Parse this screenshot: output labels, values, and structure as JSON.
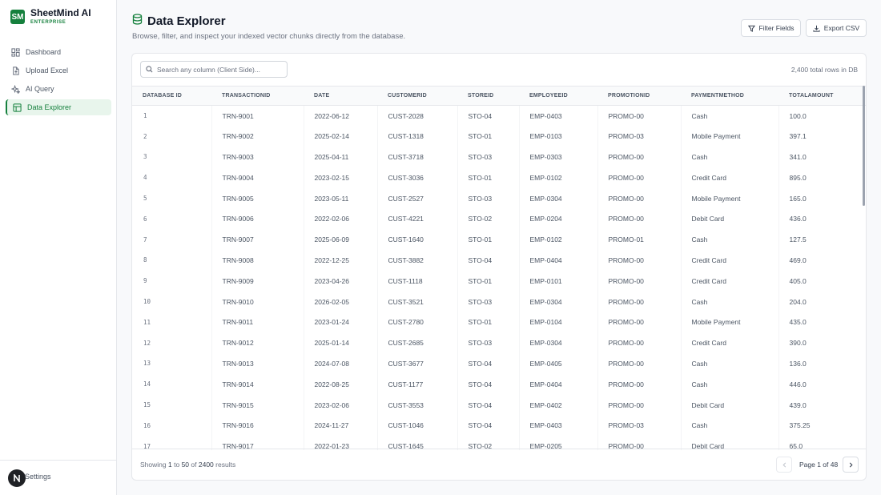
{
  "brand": {
    "logo": "SM",
    "name": "SheetMind AI",
    "sub": "ENTERPRISE"
  },
  "nav": [
    {
      "label": "Dashboard",
      "icon": "dashboard-icon"
    },
    {
      "label": "Upload Excel",
      "icon": "file-upload-icon"
    },
    {
      "label": "AI Query",
      "icon": "sparkles-icon"
    },
    {
      "label": "Data Explorer",
      "icon": "table-icon",
      "active": true
    }
  ],
  "settings_label": "Settings",
  "page": {
    "title": "Data Explorer",
    "subtitle": "Browse, filter, and inspect your indexed vector chunks directly from the database."
  },
  "actions": {
    "filter": "Filter Fields",
    "export": "Export CSV"
  },
  "search": {
    "placeholder": "Search any column (Client Side)..."
  },
  "total_rows": "2,400 total rows in DB",
  "columns": [
    "DATABASE ID",
    "TRANSACTIONID",
    "DATE",
    "CUSTOMERID",
    "STOREID",
    "EMPLOYEEID",
    "PROMOTIONID",
    "PAYMENTMETHOD",
    "TOTALAMOUNT"
  ],
  "rows": [
    [
      "1",
      "TRN-9001",
      "2022-06-12",
      "CUST-2028",
      "STO-04",
      "EMP-0403",
      "PROMO-00",
      "Cash",
      "100.0"
    ],
    [
      "2",
      "TRN-9002",
      "2025-02-14",
      "CUST-1318",
      "STO-01",
      "EMP-0103",
      "PROMO-03",
      "Mobile Payment",
      "397.1"
    ],
    [
      "3",
      "TRN-9003",
      "2025-04-11",
      "CUST-3718",
      "STO-03",
      "EMP-0303",
      "PROMO-00",
      "Cash",
      "341.0"
    ],
    [
      "4",
      "TRN-9004",
      "2023-02-15",
      "CUST-3036",
      "STO-01",
      "EMP-0102",
      "PROMO-00",
      "Credit Card",
      "895.0"
    ],
    [
      "5",
      "TRN-9005",
      "2023-05-11",
      "CUST-2527",
      "STO-03",
      "EMP-0304",
      "PROMO-00",
      "Mobile Payment",
      "165.0"
    ],
    [
      "6",
      "TRN-9006",
      "2022-02-06",
      "CUST-4221",
      "STO-02",
      "EMP-0204",
      "PROMO-00",
      "Debit Card",
      "436.0"
    ],
    [
      "7",
      "TRN-9007",
      "2025-06-09",
      "CUST-1640",
      "STO-01",
      "EMP-0102",
      "PROMO-01",
      "Cash",
      "127.5"
    ],
    [
      "8",
      "TRN-9008",
      "2022-12-25",
      "CUST-3882",
      "STO-04",
      "EMP-0404",
      "PROMO-00",
      "Credit Card",
      "469.0"
    ],
    [
      "9",
      "TRN-9009",
      "2023-04-26",
      "CUST-1118",
      "STO-01",
      "EMP-0101",
      "PROMO-00",
      "Credit Card",
      "405.0"
    ],
    [
      "10",
      "TRN-9010",
      "2026-02-05",
      "CUST-3521",
      "STO-03",
      "EMP-0304",
      "PROMO-00",
      "Cash",
      "204.0"
    ],
    [
      "11",
      "TRN-9011",
      "2023-01-24",
      "CUST-2780",
      "STO-01",
      "EMP-0104",
      "PROMO-00",
      "Mobile Payment",
      "435.0"
    ],
    [
      "12",
      "TRN-9012",
      "2025-01-14",
      "CUST-2685",
      "STO-03",
      "EMP-0304",
      "PROMO-00",
      "Credit Card",
      "390.0"
    ],
    [
      "13",
      "TRN-9013",
      "2024-07-08",
      "CUST-3677",
      "STO-04",
      "EMP-0405",
      "PROMO-00",
      "Cash",
      "136.0"
    ],
    [
      "14",
      "TRN-9014",
      "2022-08-25",
      "CUST-1177",
      "STO-04",
      "EMP-0404",
      "PROMO-00",
      "Cash",
      "446.0"
    ],
    [
      "15",
      "TRN-9015",
      "2023-02-06",
      "CUST-3553",
      "STO-04",
      "EMP-0402",
      "PROMO-00",
      "Debit Card",
      "439.0"
    ],
    [
      "16",
      "TRN-9016",
      "2024-11-27",
      "CUST-1046",
      "STO-04",
      "EMP-0403",
      "PROMO-03",
      "Cash",
      "375.25"
    ],
    [
      "17",
      "TRN-9017",
      "2022-01-23",
      "CUST-1645",
      "STO-02",
      "EMP-0205",
      "PROMO-00",
      "Debit Card",
      "65.0"
    ]
  ],
  "footer": {
    "prefix": "Showing",
    "from": "1",
    "to_word": "to",
    "to": "50",
    "of_word": "of",
    "total": "2400",
    "suffix": "results",
    "page_label": "Page 1 of 48"
  },
  "colors": {
    "accent": "#15803d",
    "accent_bg": "#e8f5ec"
  }
}
